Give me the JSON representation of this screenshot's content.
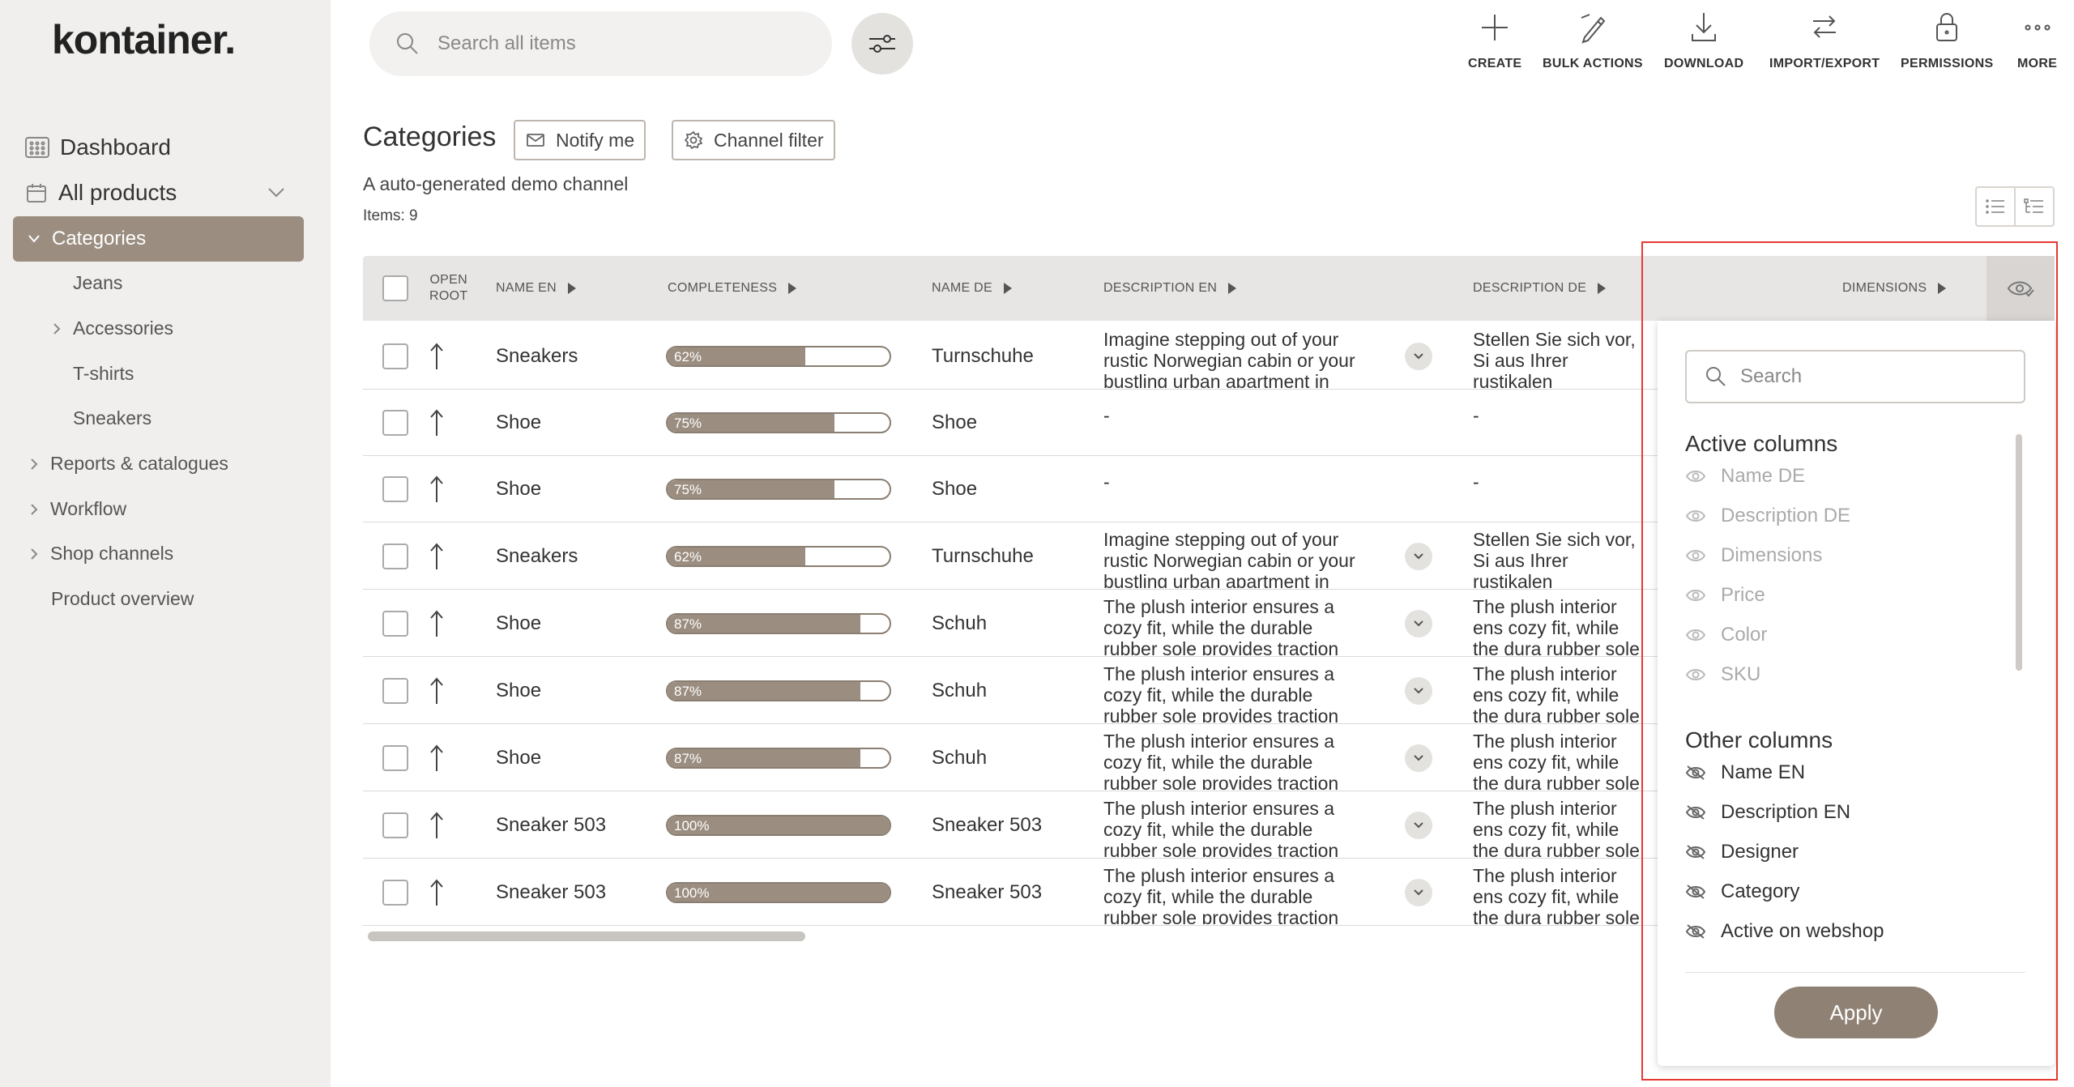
{
  "logo": "kontainer.",
  "search": {
    "placeholder": "Search all items"
  },
  "toolbar": [
    {
      "label": "CREATE",
      "icon": "plus-icon"
    },
    {
      "label": "BULK ACTIONS",
      "icon": "edit-pen-icon"
    },
    {
      "label": "DOWNLOAD",
      "icon": "download-icon"
    },
    {
      "label": "IMPORT/EXPORT",
      "icon": "import-export-icon"
    },
    {
      "label": "PERMISSIONS",
      "icon": "lock-icon"
    },
    {
      "label": "MORE",
      "icon": "more-dots-icon"
    }
  ],
  "sidebar": {
    "dashboard": "Dashboard",
    "all_products": "All products",
    "items": [
      "Categories",
      "Jeans",
      "Accessories",
      "T-shirts",
      "Sneakers",
      "Reports & catalogues",
      "Workflow",
      "Shop channels",
      "Product overview"
    ]
  },
  "page": {
    "title": "Categories",
    "notify": "Notify me",
    "channel_filter": "Channel filter",
    "subtitle": "A auto-generated demo channel",
    "items_count": "Items: 9"
  },
  "table": {
    "headers": {
      "open_root_1": "OPEN",
      "open_root_2": "ROOT",
      "name_en": "NAME EN",
      "completeness": "COMPLETENESS",
      "name_de": "NAME DE",
      "description_en": "DESCRIPTION EN",
      "description_de": "DESCRIPTION DE",
      "dimensions": "DIMENSIONS"
    },
    "rows": [
      {
        "name_en": "Sneakers",
        "completeness": 62,
        "pct": "62%",
        "name_de": "Turnschuhe",
        "desc_en": "Imagine stepping out of your rustic Norwegian cabin or your bustling urban apartment in",
        "desc_de": "Stellen Sie sich vor, Si aus Ihrer rustikalen norwegischen Hütte o",
        "expand": true
      },
      {
        "name_en": "Shoe",
        "completeness": 75,
        "pct": "75%",
        "name_de": "Shoe",
        "desc_en": "-",
        "desc_de": "-",
        "expand": false
      },
      {
        "name_en": "Shoe",
        "completeness": 75,
        "pct": "75%",
        "name_de": "Shoe",
        "desc_en": "-",
        "desc_de": "-",
        "expand": false
      },
      {
        "name_en": "Sneakers",
        "completeness": 62,
        "pct": "62%",
        "name_de": "Turnschuhe",
        "desc_en": "Imagine stepping out of your rustic Norwegian cabin or your bustling urban apartment in",
        "desc_de": "Stellen Sie sich vor, Si aus Ihrer rustikalen norwegischen Hütte o",
        "expand": true
      },
      {
        "name_en": "Shoe",
        "completeness": 87,
        "pct": "87%",
        "name_de": "Schuh",
        "desc_en": "The plush interior ensures a cozy fit, while the durable rubber sole provides traction",
        "desc_de": "The plush interior ens cozy fit, while the dura rubber sole provides t",
        "expand": true
      },
      {
        "name_en": "Shoe",
        "completeness": 87,
        "pct": "87%",
        "name_de": "Schuh",
        "desc_en": "The plush interior ensures a cozy fit, while the durable rubber sole provides traction",
        "desc_de": "The plush interior ens cozy fit, while the dura rubber sole provides t",
        "expand": true
      },
      {
        "name_en": "Shoe",
        "completeness": 87,
        "pct": "87%",
        "name_de": "Schuh",
        "desc_en": "The plush interior ensures a cozy fit, while the durable rubber sole provides traction",
        "desc_de": "The plush interior ens cozy fit, while the dura rubber sole provides t",
        "expand": true
      },
      {
        "name_en": "Sneaker 503",
        "completeness": 100,
        "pct": "100%",
        "name_de": "Sneaker 503",
        "desc_en": "The plush interior ensures a cozy fit, while the durable rubber sole provides traction",
        "desc_de": "The plush interior ens cozy fit, while the dura rubber sole provides t",
        "expand": true
      },
      {
        "name_en": "Sneaker 503",
        "completeness": 100,
        "pct": "100%",
        "name_de": "Sneaker 503",
        "desc_en": "The plush interior ensures a cozy fit, while the durable rubber sole provides traction",
        "desc_de": "The plush interior ens cozy fit, while the dura rubber sole provides t",
        "expand": true
      }
    ]
  },
  "columns_popup": {
    "search_placeholder": "Search",
    "active_title": "Active columns",
    "active": [
      "Name DE",
      "Description DE",
      "Dimensions",
      "Price",
      "Color",
      "SKU"
    ],
    "other_title": "Other columns",
    "other": [
      "Name EN",
      "Description EN",
      "Designer",
      "Category",
      "Active on webshop"
    ],
    "apply": "Apply"
  },
  "colors": {
    "accent": "#9b8e80",
    "sidebar_bg": "#f0efed",
    "highlight_frame": "#e53935"
  }
}
